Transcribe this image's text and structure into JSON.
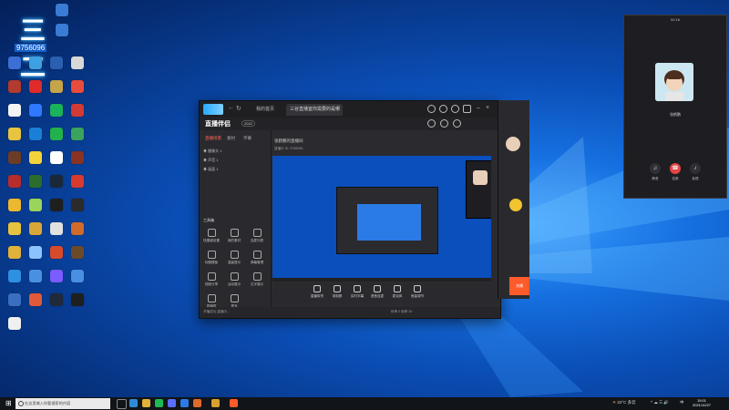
{
  "desktop": {
    "logo_text": "三二",
    "user_id": "9756096",
    "icons": [
      {
        "label": "",
        "color": "#3b6fd4"
      },
      {
        "label": "",
        "color": "#3da0e0"
      },
      {
        "label": "",
        "color": "#2b5fb0"
      },
      {
        "label": "",
        "color": "#d8d8d8"
      },
      {
        "label": "",
        "color": "#b23a2e"
      },
      {
        "label": "",
        "color": "#e02b2b"
      },
      {
        "label": "",
        "color": "#c6a44a"
      },
      {
        "label": "",
        "color": "#e94b3c"
      },
      {
        "label": "",
        "color": "#f4f4f4"
      },
      {
        "label": "",
        "color": "#2f78ff"
      },
      {
        "label": "",
        "color": "#1ab25a"
      },
      {
        "label": "",
        "color": "#d23a33"
      },
      {
        "label": "",
        "color": "#e7c43f"
      },
      {
        "label": "",
        "color": "#1a7fd6"
      },
      {
        "label": "",
        "color": "#22b14c"
      },
      {
        "label": "",
        "color": "#3aa35e"
      },
      {
        "label": "",
        "color": "#6c3d26"
      },
      {
        "label": "",
        "color": "#f5d33a"
      },
      {
        "label": "",
        "color": "#ffffff"
      },
      {
        "label": "",
        "color": "#8a3322"
      },
      {
        "label": "",
        "color": "#b72c2c"
      },
      {
        "label": "",
        "color": "#2c6c2c"
      },
      {
        "label": "",
        "color": "#1b2838"
      },
      {
        "label": "",
        "color": "#d73b2f"
      },
      {
        "label": "",
        "color": "#ecb82f"
      },
      {
        "label": "",
        "color": "#9ad45c"
      },
      {
        "label": "",
        "color": "#1f1f1f"
      },
      {
        "label": "",
        "color": "#2b2b2b"
      },
      {
        "label": "",
        "color": "#e7c43f"
      },
      {
        "label": "",
        "color": "#d9a63a"
      },
      {
        "label": "",
        "color": "#e0e0e0"
      },
      {
        "label": "",
        "color": "#d26a2a"
      },
      {
        "label": "",
        "color": "#e0b23a"
      },
      {
        "label": "",
        "color": "#8cc3ff"
      },
      {
        "label": "",
        "color": "#d84a2a"
      },
      {
        "label": "",
        "color": "#6b4a2a"
      },
      {
        "label": "",
        "color": "#2f8fe0"
      },
      {
        "label": "",
        "color": "#4a90e2"
      },
      {
        "label": "",
        "color": "#7a5cff"
      },
      {
        "label": "",
        "color": "#4a90e2"
      },
      {
        "label": "",
        "color": "#3a6fc0"
      },
      {
        "label": "",
        "color": "#e05a3a"
      },
      {
        "label": "",
        "color": "#1f2a3a"
      },
      {
        "label": "",
        "color": "#1f1f1f"
      },
      {
        "label": "",
        "color": "#f0f0f0"
      }
    ]
  },
  "app": {
    "nav_label": "我的首页",
    "tab_title": "三谷直播室你需要的是哪里",
    "brand": "直播伴侣",
    "version": "2022",
    "left_tabs": [
      "直播场景",
      "素材",
      "字幕"
    ],
    "sources": [
      "摄像头 1",
      "声音 1",
      "画面 1"
    ],
    "tools_title": "工具箱",
    "tools": [
      "快捷键设置",
      "我的素材",
      "连麦列表",
      "标题模板",
      "温馨提示",
      "弹幕管理",
      "视频分享",
      "活动展示",
      "文字展示",
      "直播秀",
      "更多"
    ],
    "room_title": "张鹤鹏的直播间",
    "room_sub": "直播中 ID: 9756096",
    "bottom_buttons": [
      "直播带货",
      "录制屏",
      "实时字幕",
      "语音连麦",
      "麦克风",
      "音量调节"
    ],
    "status_left": "开播成功,直播中...",
    "status_right": "码率 0  帧率 30"
  },
  "chat": {
    "go_live": "关播"
  },
  "call": {
    "time": "00:16",
    "name": "张鹤鹏",
    "buttons": [
      "静音",
      "挂断",
      "免提"
    ]
  },
  "taskbar": {
    "search_placeholder": "在这里输入你要搜索的内容",
    "weather": "22°C 多云",
    "ime": "中",
    "time": "15:01",
    "date": "2021/10/27"
  }
}
